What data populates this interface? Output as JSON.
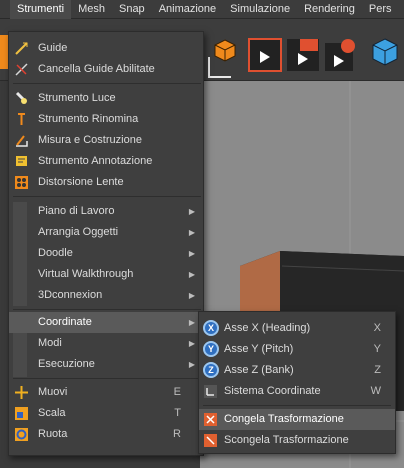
{
  "menubar": [
    "",
    "Strumenti",
    "Mesh",
    "Snap",
    "Animazione",
    "Simulazione",
    "Rendering",
    "Pers"
  ],
  "menu": {
    "group1": [
      {
        "label": "Guide",
        "icon": "guide-icon"
      },
      {
        "label": "Cancella Guide Abilitate",
        "icon": "clear-guides-icon"
      }
    ],
    "group2": [
      {
        "label": "Strumento Luce",
        "icon": "light-tool-icon"
      },
      {
        "label": "Strumento Rinomina",
        "icon": "rename-tool-icon"
      },
      {
        "label": "Misura e Costruzione",
        "icon": "measure-icon"
      },
      {
        "label": "Strumento Annotazione",
        "icon": "annotation-icon"
      },
      {
        "label": "Distorsione Lente",
        "icon": "lens-distortion-icon"
      }
    ],
    "group3": [
      {
        "label": "Piano di Lavoro",
        "arrow": "▶"
      },
      {
        "label": "Arrangia Oggetti",
        "arrow": "▶"
      },
      {
        "label": "Doodle",
        "arrow": "▶"
      },
      {
        "label": "Virtual Walkthrough",
        "arrow": "▶"
      },
      {
        "label": "3Dconnexion",
        "arrow": "▶"
      }
    ],
    "group4": [
      {
        "label": "Coordinate",
        "arrow": "▶"
      },
      {
        "label": "Modi",
        "arrow": "▶"
      },
      {
        "label": "Esecuzione",
        "arrow": "▶"
      }
    ],
    "group5": [
      {
        "label": "Muovi",
        "key": "E",
        "icon": "move-icon"
      },
      {
        "label": "Scala",
        "key": "T",
        "icon": "scale-icon"
      },
      {
        "label": "Ruota",
        "key": "R",
        "icon": "rotate-icon"
      }
    ]
  },
  "submenu": [
    {
      "label": "Asse X (Heading)",
      "key": "X",
      "badge": "X"
    },
    {
      "label": "Asse Y (Pitch)",
      "key": "Y",
      "badge": "Y"
    },
    {
      "label": "Asse Z (Bank)",
      "key": "Z",
      "badge": "Z"
    },
    {
      "label": "Sistema Coordinate",
      "key": "W"
    },
    {
      "label": "Congela Trasformazione"
    },
    {
      "label": "Scongela Trasformazione"
    }
  ],
  "colors": {
    "accent_orange": "#f08a1c",
    "badge_blue": "#2f6fc0",
    "highlight": "#5a5a5a"
  }
}
